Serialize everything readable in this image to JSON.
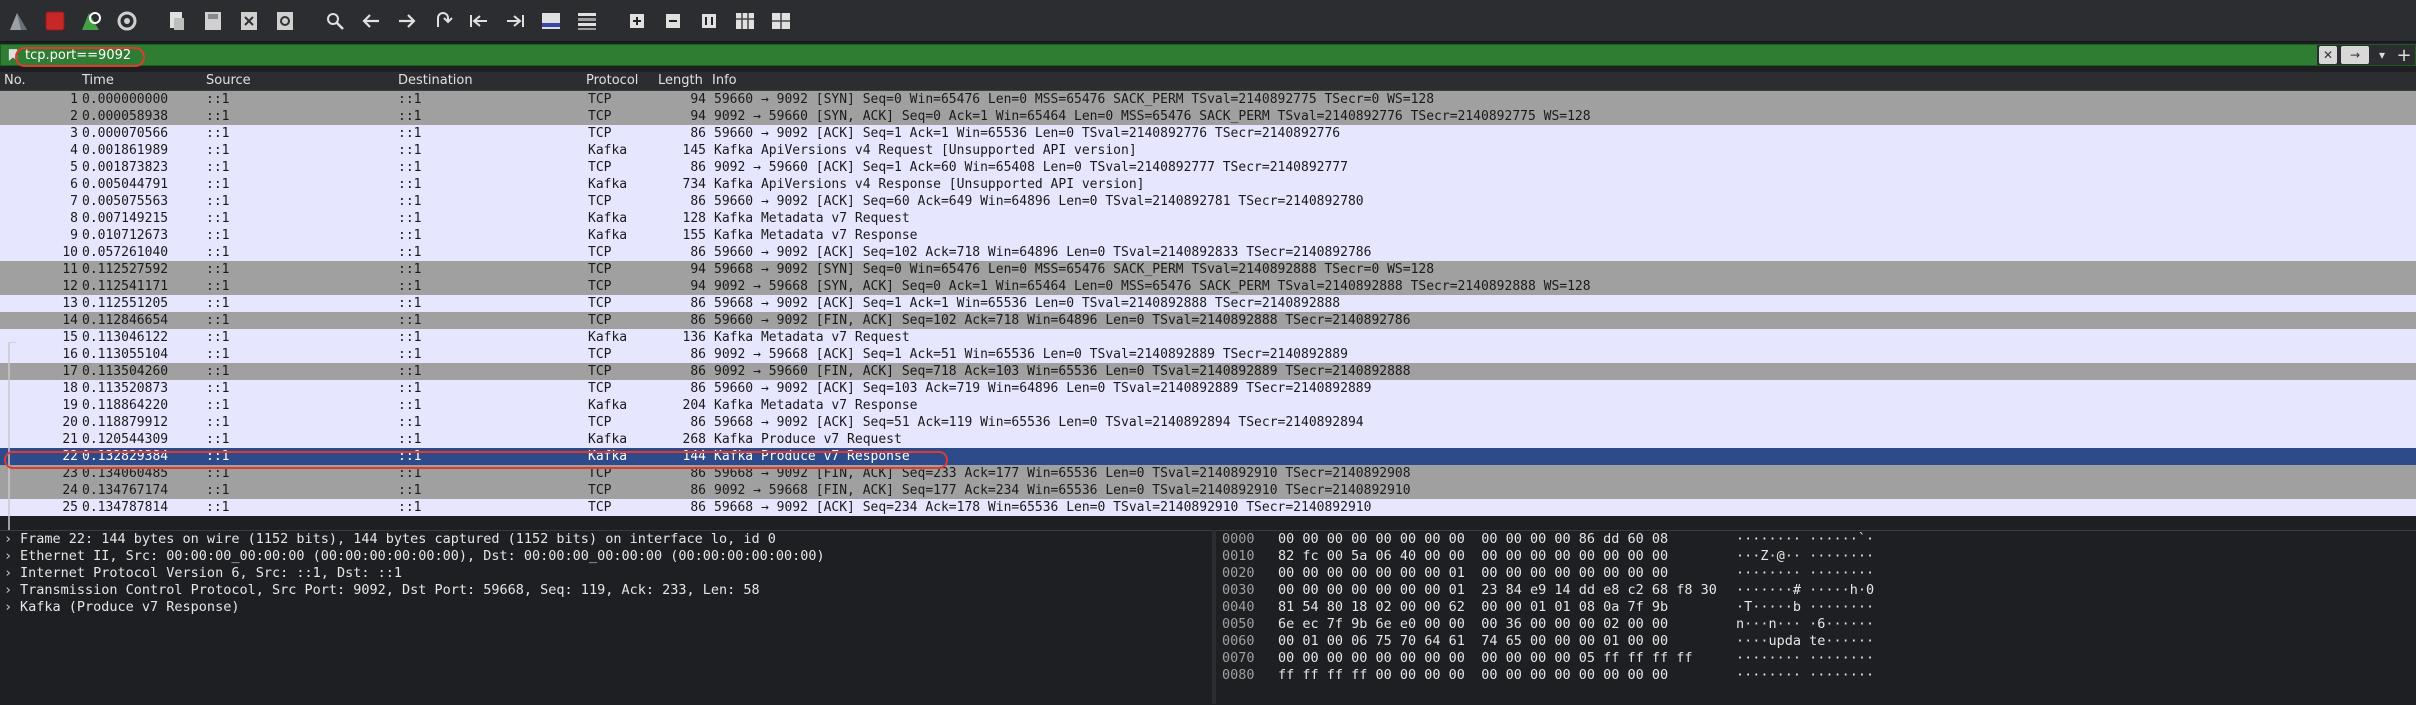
{
  "toolbar": {
    "icons": [
      "shark-fin-icon",
      "stop-capture-icon",
      "restart-capture-icon",
      "capture-options-icon",
      "open-file-icon",
      "save-file-icon",
      "close-file-icon",
      "reload-file-icon",
      "find-packet-icon",
      "go-back-icon",
      "go-forward-icon",
      "go-to-packet-icon",
      "go-first-icon",
      "go-last-icon",
      "auto-scroll-icon",
      "colorize-icon",
      "zoom-in-icon",
      "zoom-out-icon",
      "normal-size-icon",
      "resize-columns-icon"
    ]
  },
  "filter": {
    "value": "tcp.port==9092"
  },
  "columns": [
    "No.",
    "Time",
    "Source",
    "Destination",
    "Protocol",
    "Length",
    "Info"
  ],
  "colors": {
    "tcp_row": "#e7e6ff",
    "handshake_row": "#a0a0a0",
    "selected_row": "#2d4a8a",
    "filter_bg": "#2e7d32",
    "highlight_ring": "#e03a2e"
  },
  "packets": [
    {
      "no": "1",
      "time": "0.000000000",
      "src": "::1",
      "dst": "::1",
      "proto": "TCP",
      "len": "94",
      "info": "59660 → 9092 [SYN] Seq=0 Win=65476 Len=0 MSS=65476 SACK_PERM TSval=2140892775 TSecr=0 WS=128",
      "style": "gray"
    },
    {
      "no": "2",
      "time": "0.000058938",
      "src": "::1",
      "dst": "::1",
      "proto": "TCP",
      "len": "94",
      "info": "9092 → 59660 [SYN, ACK] Seq=0 Ack=1 Win=65464 Len=0 MSS=65476 SACK_PERM TSval=2140892776 TSecr=2140892775 WS=128",
      "style": "gray"
    },
    {
      "no": "3",
      "time": "0.000070566",
      "src": "::1",
      "dst": "::1",
      "proto": "TCP",
      "len": "86",
      "info": "59660 → 9092 [ACK] Seq=1 Ack=1 Win=65536 Len=0 TSval=2140892776 TSecr=2140892776",
      "style": "tcp"
    },
    {
      "no": "4",
      "time": "0.001861989",
      "src": "::1",
      "dst": "::1",
      "proto": "Kafka",
      "len": "145",
      "info": "Kafka ApiVersions v4 Request [Unsupported API version]",
      "style": "tcp"
    },
    {
      "no": "5",
      "time": "0.001873823",
      "src": "::1",
      "dst": "::1",
      "proto": "TCP",
      "len": "86",
      "info": "9092 → 59660 [ACK] Seq=1 Ack=60 Win=65408 Len=0 TSval=2140892777 TSecr=2140892777",
      "style": "tcp"
    },
    {
      "no": "6",
      "time": "0.005044791",
      "src": "::1",
      "dst": "::1",
      "proto": "Kafka",
      "len": "734",
      "info": "Kafka ApiVersions v4 Response [Unsupported API version]",
      "style": "tcp"
    },
    {
      "no": "7",
      "time": "0.005075563",
      "src": "::1",
      "dst": "::1",
      "proto": "TCP",
      "len": "86",
      "info": "59660 → 9092 [ACK] Seq=60 Ack=649 Win=64896 Len=0 TSval=2140892781 TSecr=2140892780",
      "style": "tcp"
    },
    {
      "no": "8",
      "time": "0.007149215",
      "src": "::1",
      "dst": "::1",
      "proto": "Kafka",
      "len": "128",
      "info": "Kafka Metadata v7 Request",
      "style": "tcp"
    },
    {
      "no": "9",
      "time": "0.010712673",
      "src": "::1",
      "dst": "::1",
      "proto": "Kafka",
      "len": "155",
      "info": "Kafka Metadata v7 Response",
      "style": "tcp"
    },
    {
      "no": "10",
      "time": "0.057261040",
      "src": "::1",
      "dst": "::1",
      "proto": "TCP",
      "len": "86",
      "info": "59660 → 9092 [ACK] Seq=102 Ack=718 Win=64896 Len=0 TSval=2140892833 TSecr=2140892786",
      "style": "tcp"
    },
    {
      "no": "11",
      "time": "0.112527592",
      "src": "::1",
      "dst": "::1",
      "proto": "TCP",
      "len": "94",
      "info": "59668 → 9092 [SYN] Seq=0 Win=65476 Len=0 MSS=65476 SACK_PERM TSval=2140892888 TSecr=0 WS=128",
      "style": "gray"
    },
    {
      "no": "12",
      "time": "0.112541171",
      "src": "::1",
      "dst": "::1",
      "proto": "TCP",
      "len": "94",
      "info": "9092 → 59668 [SYN, ACK] Seq=0 Ack=1 Win=65464 Len=0 MSS=65476 SACK_PERM TSval=2140892888 TSecr=2140892888 WS=128",
      "style": "gray"
    },
    {
      "no": "13",
      "time": "0.112551205",
      "src": "::1",
      "dst": "::1",
      "proto": "TCP",
      "len": "86",
      "info": "59668 → 9092 [ACK] Seq=1 Ack=1 Win=65536 Len=0 TSval=2140892888 TSecr=2140892888",
      "style": "tcp"
    },
    {
      "no": "14",
      "time": "0.112846654",
      "src": "::1",
      "dst": "::1",
      "proto": "TCP",
      "len": "86",
      "info": "59660 → 9092 [FIN, ACK] Seq=102 Ack=718 Win=64896 Len=0 TSval=2140892888 TSecr=2140892786",
      "style": "gray"
    },
    {
      "no": "15",
      "time": "0.113046122",
      "src": "::1",
      "dst": "::1",
      "proto": "Kafka",
      "len": "136",
      "info": "Kafka Metadata v7 Request",
      "style": "tcp"
    },
    {
      "no": "16",
      "time": "0.113055104",
      "src": "::1",
      "dst": "::1",
      "proto": "TCP",
      "len": "86",
      "info": "9092 → 59668 [ACK] Seq=1 Ack=51 Win=65536 Len=0 TSval=2140892889 TSecr=2140892889",
      "style": "tcp"
    },
    {
      "no": "17",
      "time": "0.113504260",
      "src": "::1",
      "dst": "::1",
      "proto": "TCP",
      "len": "86",
      "info": "9092 → 59660 [FIN, ACK] Seq=718 Ack=103 Win=65536 Len=0 TSval=2140892889 TSecr=2140892888",
      "style": "gray"
    },
    {
      "no": "18",
      "time": "0.113520873",
      "src": "::1",
      "dst": "::1",
      "proto": "TCP",
      "len": "86",
      "info": "59660 → 9092 [ACK] Seq=103 Ack=719 Win=64896 Len=0 TSval=2140892889 TSecr=2140892889",
      "style": "tcp"
    },
    {
      "no": "19",
      "time": "0.118864220",
      "src": "::1",
      "dst": "::1",
      "proto": "Kafka",
      "len": "204",
      "info": "Kafka Metadata v7 Response",
      "style": "tcp"
    },
    {
      "no": "20",
      "time": "0.118879912",
      "src": "::1",
      "dst": "::1",
      "proto": "TCP",
      "len": "86",
      "info": "59668 → 9092 [ACK] Seq=51 Ack=119 Win=65536 Len=0 TSval=2140892894 TSecr=2140892894",
      "style": "tcp"
    },
    {
      "no": "21",
      "time": "0.120544309",
      "src": "::1",
      "dst": "::1",
      "proto": "Kafka",
      "len": "268",
      "info": "Kafka Produce v7 Request",
      "style": "tcp"
    },
    {
      "no": "22",
      "time": "0.132829384",
      "src": "::1",
      "dst": "::1",
      "proto": "Kafka",
      "len": "144",
      "info": "Kafka Produce v7 Response",
      "style": "selected"
    },
    {
      "no": "23",
      "time": "0.134060485",
      "src": "::1",
      "dst": "::1",
      "proto": "TCP",
      "len": "86",
      "info": "59668 → 9092 [FIN, ACK] Seq=233 Ack=177 Win=65536 Len=0 TSval=2140892910 TSecr=2140892908",
      "style": "gray"
    },
    {
      "no": "24",
      "time": "0.134767174",
      "src": "::1",
      "dst": "::1",
      "proto": "TCP",
      "len": "86",
      "info": "9092 → 59668 [FIN, ACK] Seq=177 Ack=234 Win=65536 Len=0 TSval=2140892910 TSecr=2140892910",
      "style": "gray"
    },
    {
      "no": "25",
      "time": "0.134787814",
      "src": "::1",
      "dst": "::1",
      "proto": "TCP",
      "len": "86",
      "info": "59668 → 9092 [ACK] Seq=234 Ack=178 Win=65536 Len=0 TSval=2140892910 TSecr=2140892910",
      "style": "tcp"
    }
  ],
  "details": [
    "Frame 22: 144 bytes on wire (1152 bits), 144 bytes captured (1152 bits) on interface lo, id 0",
    "Ethernet II, Src: 00:00:00_00:00:00 (00:00:00:00:00:00), Dst: 00:00:00_00:00:00 (00:00:00:00:00:00)",
    "Internet Protocol Version 6, Src: ::1, Dst: ::1",
    "Transmission Control Protocol, Src Port: 9092, Dst Port: 59668, Seq: 119, Ack: 233, Len: 58",
    "Kafka (Produce v7 Response)"
  ],
  "hex": [
    {
      "offset": "0000",
      "bytes": "00 00 00 00 00 00 00 00  00 00 00 00 86 dd 60 08",
      "ascii": "········ ······`·"
    },
    {
      "offset": "0010",
      "bytes": "82 fc 00 5a 06 40 00 00  00 00 00 00 00 00 00 00",
      "ascii": "···Z·@·· ········"
    },
    {
      "offset": "0020",
      "bytes": "00 00 00 00 00 00 00 01  00 00 00 00 00 00 00 00",
      "ascii": "········ ········"
    },
    {
      "offset": "0030",
      "bytes": "00 00 00 00 00 00 00 01  23 84 e9 14 dd e8 c2 68 f8 30",
      "ascii": "·······# ·····h·0"
    },
    {
      "offset": "0040",
      "bytes": "81 54 80 18 02 00 00 62  00 00 01 01 08 0a 7f 9b",
      "ascii": "·T·····b ········"
    },
    {
      "offset": "0050",
      "bytes": "6e ec 7f 9b 6e e0 00 00  00 36 00 00 00 02 00 00",
      "ascii": "n···n··· ·6······"
    },
    {
      "offset": "0060",
      "bytes": "00 01 00 06 75 70 64 61  74 65 00 00 00 01 00 00",
      "ascii": "····upda te······"
    },
    {
      "offset": "0070",
      "bytes": "00 00 00 00 00 00 00 00  00 00 00 00 05 ff ff ff ff",
      "ascii": "········ ········"
    },
    {
      "offset": "0080",
      "bytes": "ff ff ff ff 00 00 00 00  00 00 00 00 00 00 00 00",
      "ascii": "········ ········"
    }
  ]
}
